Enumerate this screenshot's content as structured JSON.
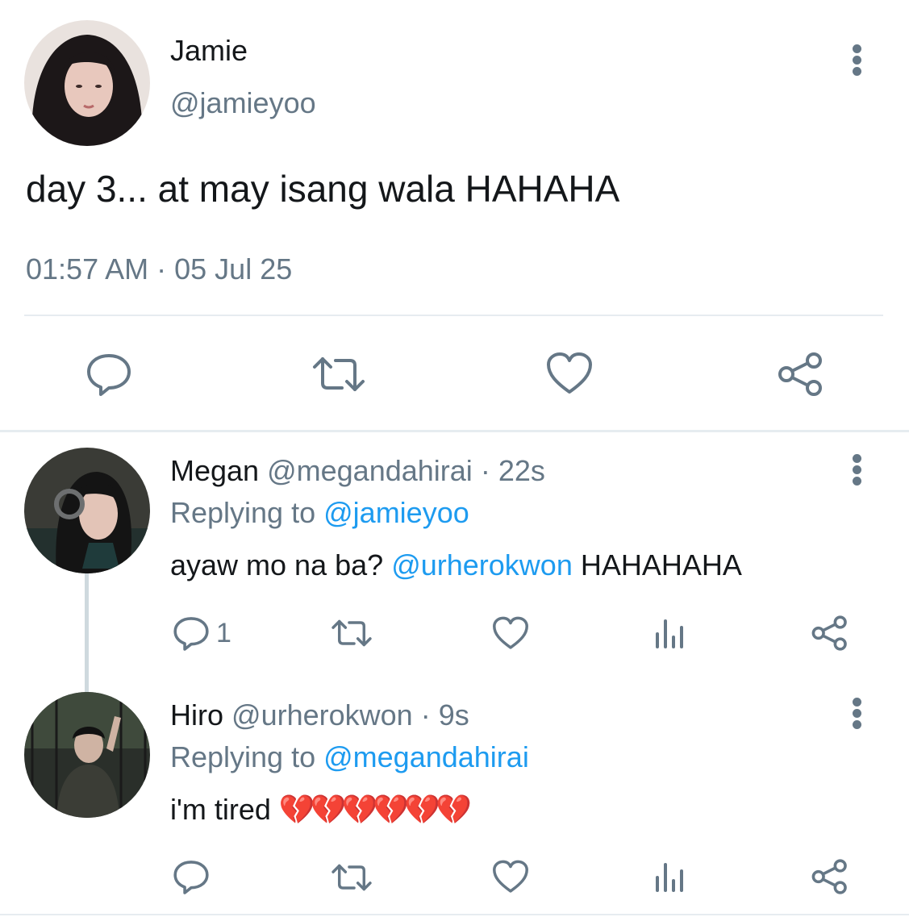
{
  "main_tweet": {
    "author_name": "Jamie",
    "author_handle": "@jamieyoo",
    "text": "day 3... at may isang wala HAHAHA",
    "time": "01:57 AM",
    "separator": "·",
    "date": "05 Jul 25",
    "avatar_icon": "profile-photo",
    "actions": [
      "reply-icon",
      "retweet-icon",
      "like-icon",
      "share-icon"
    ]
  },
  "replies": [
    {
      "author_name": "Megan",
      "author_handle": "@megandahirai",
      "separator": "·",
      "age": "22s",
      "replying_prefix": "Replying to",
      "replying_to": "@jamieyoo",
      "text_before": "ayaw mo na ba?",
      "mention": "@urherokwon",
      "text_after": "HAHAHAHA",
      "reply_count": "1"
    },
    {
      "author_name": "Hiro",
      "author_handle": "@urherokwon",
      "separator": "·",
      "age": "9s",
      "replying_prefix": "Replying to",
      "replying_to": "@megandahirai",
      "text": "i'm tired",
      "emoji": "💔💔💔💔💔💔"
    }
  ],
  "colors": {
    "text": "#14171a",
    "secondary": "#657786",
    "link": "#1d9bf0",
    "divider": "#e6ecf0"
  }
}
